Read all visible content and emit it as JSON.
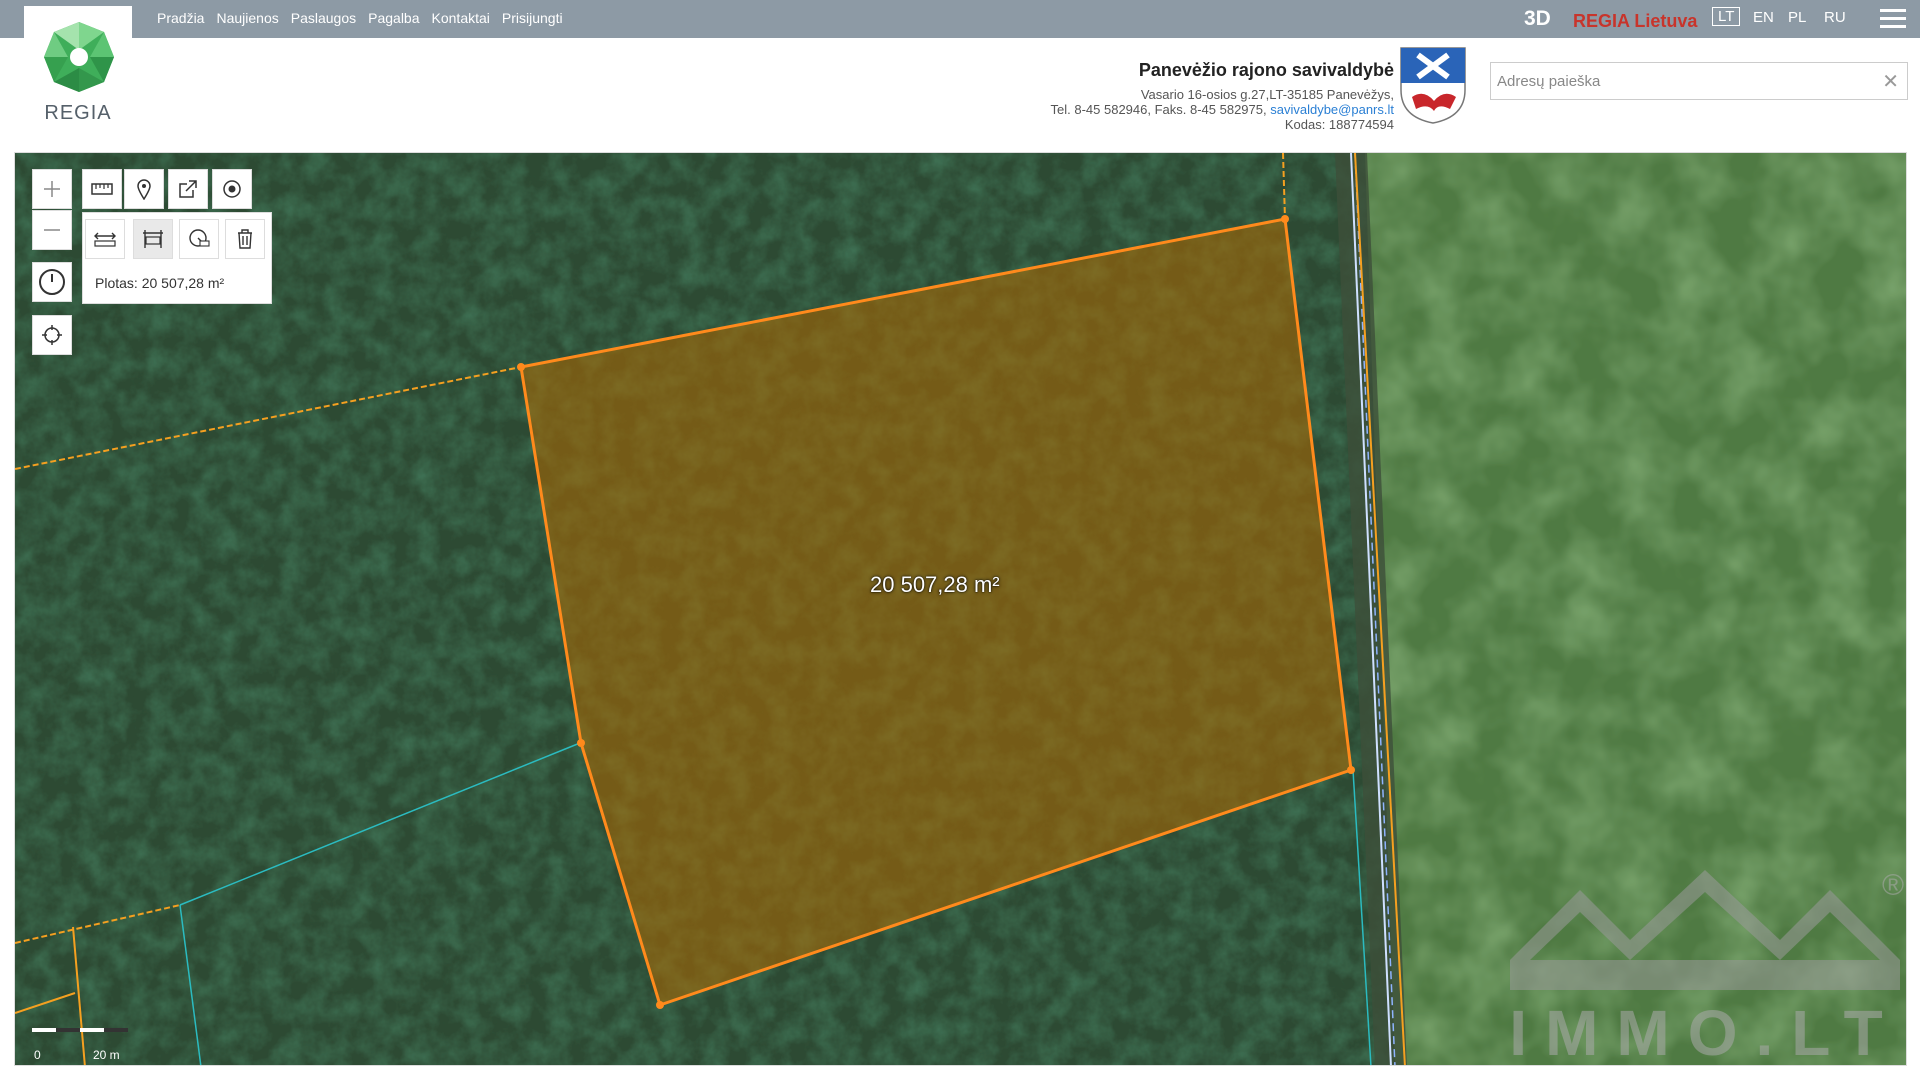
{
  "nav": {
    "items": [
      "Pradžia",
      "Naujienos",
      "Paslaugos",
      "Pagalba",
      "Kontaktai",
      "Prisijungti"
    ]
  },
  "brand": {
    "logo_text": "REGIA",
    "accent": "#4bbf6b"
  },
  "top_right": {
    "three_d": "3D",
    "regia_lietuva": "REGIA Lietuva",
    "languages": [
      "LT",
      "EN",
      "PL",
      "RU"
    ],
    "active_language": "LT"
  },
  "header": {
    "title": "Panevėžio rajono savivaldybė",
    "address": "Vasario 16-osios g.27,LT-35185 Panevėžys,",
    "phone": "Tel. 8-45 582946, Faks. 8-45 582975,",
    "email": "savivaldybe@panrs.lt",
    "code": "Kodas: 188774594"
  },
  "search": {
    "placeholder": "Adresų paieška",
    "value": ""
  },
  "map": {
    "measure_label": "Plotas: 20 507,28 m²",
    "area_label": "20 507,28 m²",
    "scale_start": "0",
    "scale_end": "20 m",
    "polygon_color": "#ff8a1c",
    "parcel_line_color": "#f5a020",
    "cadastre_line_color": "#2bbbc0",
    "road_line_color": "#8fb4ff"
  },
  "watermark": {
    "text": "IMMO.LT",
    "registered": "®"
  },
  "icons": {
    "zoom_in": "plus-icon",
    "zoom_out": "minus-icon",
    "history": "clock-icon",
    "locate": "crosshair-icon",
    "measure": "ruler-icon",
    "marker": "map-pin-icon",
    "share": "share-icon",
    "target": "target-icon",
    "measure_distance": "measure-distance-icon",
    "measure_area": "measure-area-icon",
    "measure_radius": "measure-radius-icon",
    "delete": "trash-icon"
  }
}
